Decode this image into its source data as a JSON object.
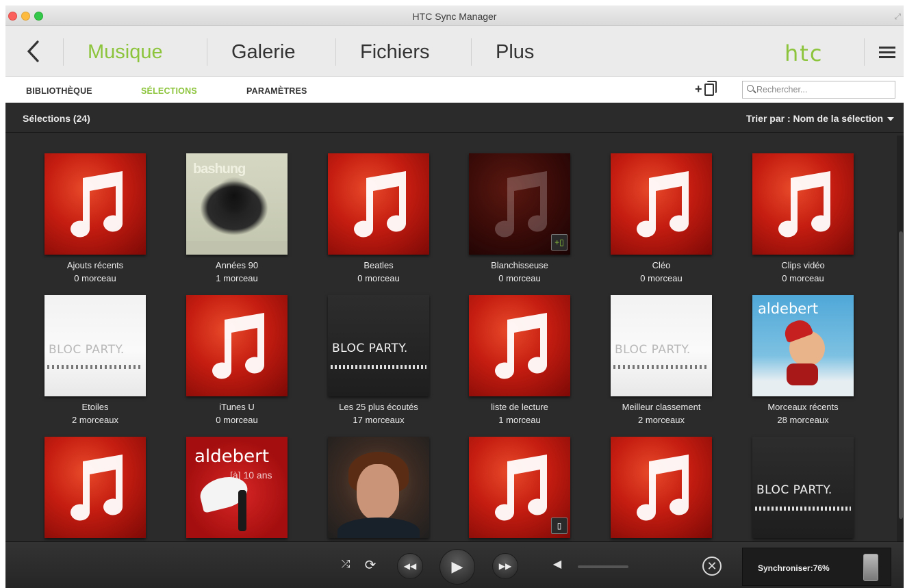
{
  "window": {
    "title": "HTC Sync Manager"
  },
  "nav": {
    "tabs": [
      {
        "label": "Musique",
        "active": true
      },
      {
        "label": "Galerie",
        "active": false
      },
      {
        "label": "Fichiers",
        "active": false
      },
      {
        "label": "Plus",
        "active": false
      }
    ],
    "logo": "htc"
  },
  "subnav": {
    "tabs": [
      {
        "label": "BIBLIOTHÈQUE",
        "active": false
      },
      {
        "label": "SÉLECTIONS",
        "active": true
      },
      {
        "label": "PARAMÈTRES",
        "active": false
      }
    ],
    "search_placeholder": "Rechercher..."
  },
  "content": {
    "count_label": "Sélections (24)",
    "sort_label": "Trier par : Nom de la sélection"
  },
  "playlists": [
    {
      "name": "Ajouts récents",
      "count": "0 morceau",
      "art": "music-note"
    },
    {
      "name": "Années 90",
      "count": "1 morceau",
      "art": "bashung",
      "art_text": "bashung"
    },
    {
      "name": "Beatles",
      "count": "0 morceau",
      "art": "music-note"
    },
    {
      "name": "Blanchisseuse",
      "count": "0 morceau",
      "art": "music-note-dim",
      "badge": "sync-to-phone-icon"
    },
    {
      "name": "Cléo",
      "count": "0 morceau",
      "art": "music-note"
    },
    {
      "name": "Clips vidéo",
      "count": "0 morceau",
      "art": "music-note"
    },
    {
      "name": "Etoiles",
      "count": "2 morceaux",
      "art": "bloc-party-white",
      "art_text": "BLOC PARTY."
    },
    {
      "name": "iTunes U",
      "count": "0 morceau",
      "art": "music-note"
    },
    {
      "name": "Les 25 plus écoutés",
      "count": "17 morceaux",
      "art": "bloc-party-dark",
      "art_text": "BLOC PARTY."
    },
    {
      "name": "liste de lecture",
      "count": "1 morceau",
      "art": "music-note"
    },
    {
      "name": "Meilleur classement",
      "count": "2 morceaux",
      "art": "bloc-party-white",
      "art_text": "BLOC PARTY."
    },
    {
      "name": "Morceaux récents",
      "count": "28 morceaux",
      "art": "aldebert-blue",
      "art_text": "aldebert"
    },
    {
      "art": "music-note"
    },
    {
      "art": "aldebert-red",
      "art_text": "aldebert",
      "art_subtext": "[à] 10 ans"
    },
    {
      "art": "portrait"
    },
    {
      "art": "music-note",
      "badge": "phone-icon"
    },
    {
      "art": "music-note"
    },
    {
      "art": "bloc-party-dark",
      "art_text": "BLOC PARTY."
    }
  ],
  "player": {
    "sync_label": "Synchroniser:76%",
    "sync_progress": 0.76
  }
}
